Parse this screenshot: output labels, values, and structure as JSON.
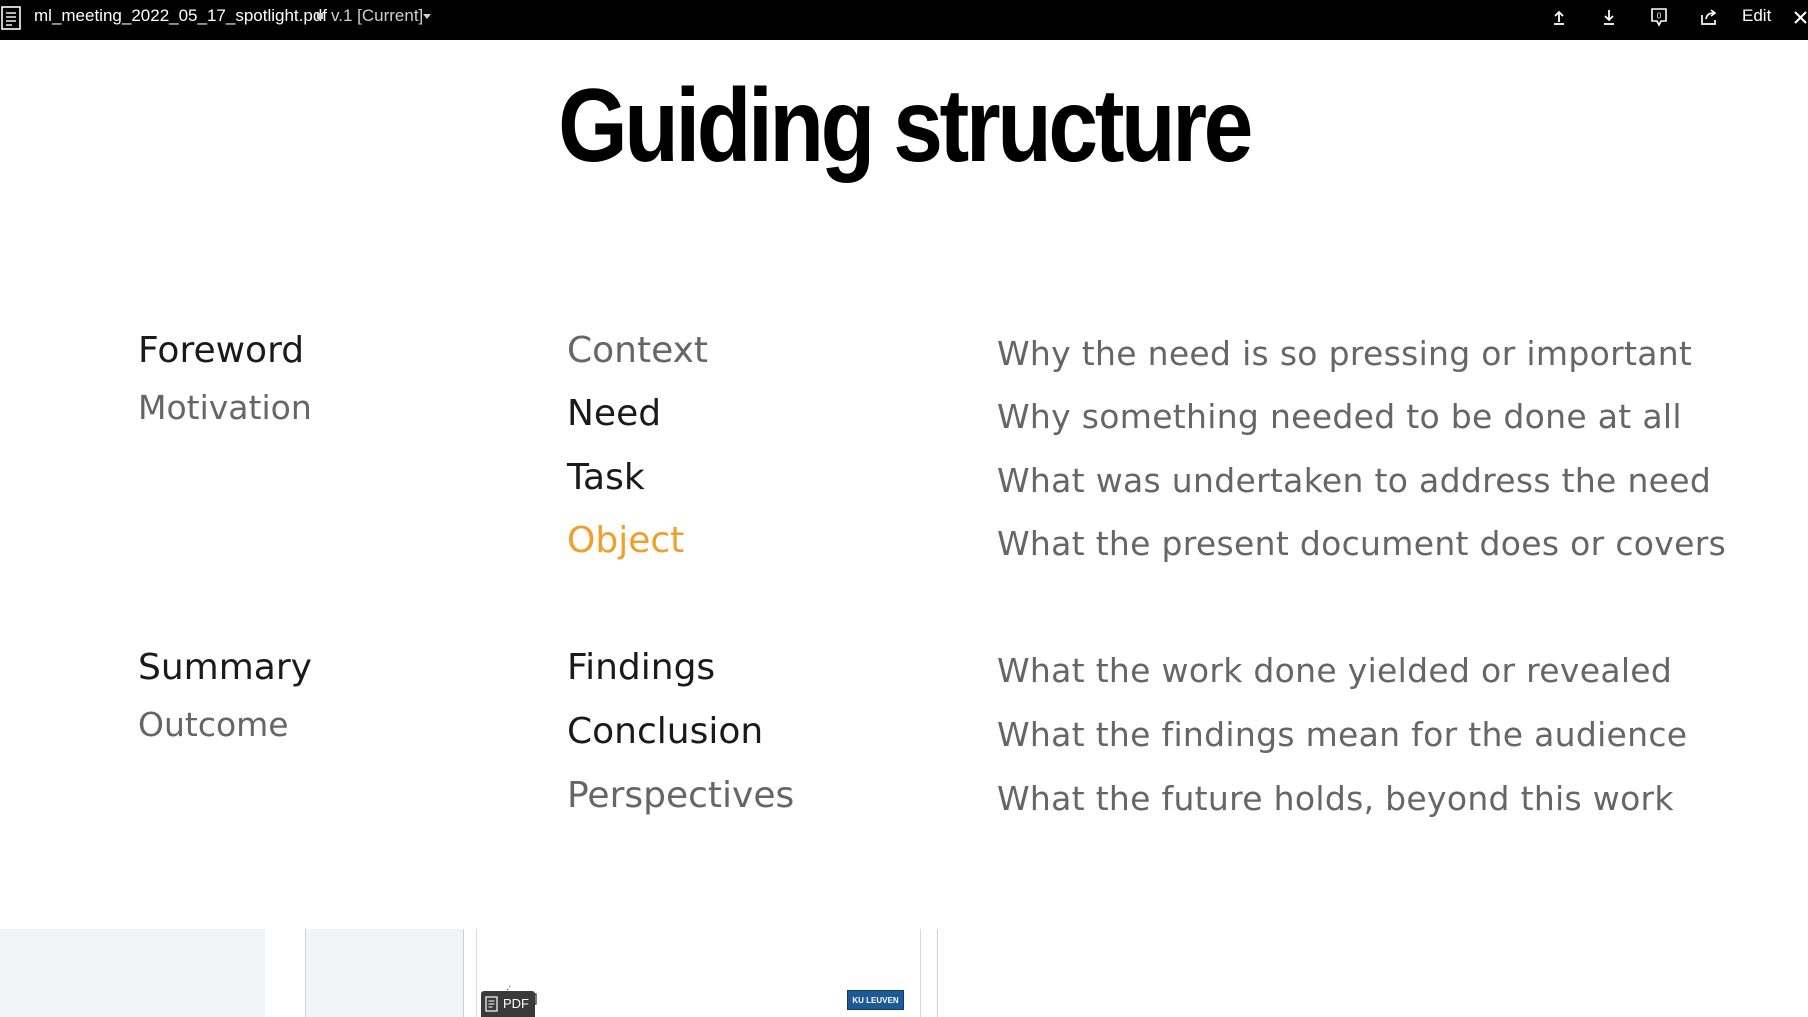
{
  "toolbar": {
    "filename": "ml_meeting_2022_05_17_spotlight.pdf",
    "version": "v.1 [Current]",
    "edit_label": "Edit",
    "icons": [
      "file-icon",
      "upload-icon",
      "download-icon",
      "comment-icon",
      "share-icon",
      "close-icon"
    ],
    "comment_count": "0"
  },
  "slide": {
    "title": "Guiding structure",
    "sections": [
      {
        "heading": "Foreword",
        "subheading": "Motivation",
        "rows": [
          {
            "term": "Context",
            "description": "Why the need is so pressing or important",
            "style": "grey"
          },
          {
            "term": "Need",
            "description": "Why something needed to be done at all",
            "style": "dark"
          },
          {
            "term": "Task",
            "description": "What was undertaken to address the need",
            "style": "dark"
          },
          {
            "term": "Object",
            "description": "What the present document does or covers",
            "style": "orange"
          }
        ]
      },
      {
        "heading": "Summary",
        "subheading": "Outcome",
        "rows": [
          {
            "term": "Findings",
            "description": "What the work done yielded or revealed",
            "style": "dark"
          },
          {
            "term": "Conclusion",
            "description": "What the findings mean for the audience",
            "style": "dark"
          },
          {
            "term": "Perspectives",
            "description": "What the future holds, beyond this work",
            "style": "grey"
          }
        ]
      }
    ],
    "accent_color": "#f0a02a"
  },
  "filmstrip": {
    "badge_label": "PDF",
    "logo_text": "KU LEUVEN"
  }
}
